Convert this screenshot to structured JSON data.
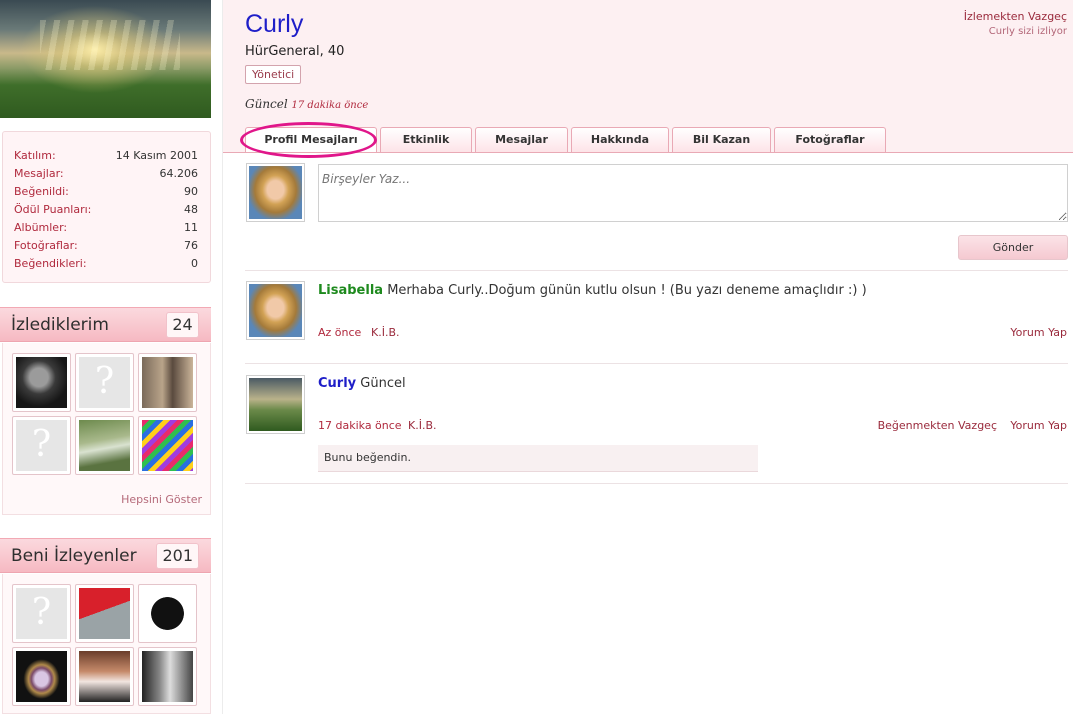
{
  "sidebar": {
    "stats": [
      {
        "label": "Katılım:",
        "value": "14 Kasım 2001"
      },
      {
        "label": "Mesajlar:",
        "value": "64.206"
      },
      {
        "label": "Beğenildi:",
        "value": "90"
      },
      {
        "label": "Ödül Puanları:",
        "value": "48"
      },
      {
        "label": "Albümler:",
        "value": "11"
      },
      {
        "label": "Fotoğraflar:",
        "value": "76"
      },
      {
        "label": "Beğendikleri:",
        "value": "0"
      }
    ],
    "following": {
      "title": "İzlediklerim",
      "count": "24",
      "show_all": "Hepsini Göster"
    },
    "followers": {
      "title": "Beni İzleyenler",
      "count": "201"
    }
  },
  "profile": {
    "username": "Curly",
    "usertitle": "HürGeneral, 40",
    "role": "Yönetici",
    "status_text": "Güncel",
    "status_time": "17 dakika önce",
    "unfollow_label": "İzlemekten Vazgeç",
    "follows_you": "Curly sizi izliyor"
  },
  "tabs": [
    "Profil Mesajları",
    "Etkinlik",
    "Mesajlar",
    "Hakkında",
    "Bil Kazan",
    "Fotoğraflar"
  ],
  "composer": {
    "placeholder": "Birşeyler Yaz...",
    "send_label": "Gönder"
  },
  "posts": [
    {
      "author": "Lisabella",
      "text": "Merhaba Curly..Doğum günün kutlu olsun ! (Bu yazı deneme amaçlıdır :) )",
      "time": "Az önce",
      "kib": "K.İ.B.",
      "reply": "Yorum Yap"
    },
    {
      "author": "Curly",
      "text": "Güncel",
      "time": "17 dakika önce",
      "kib": "K.İ.B.",
      "unlike": "Beğenmekten Vazgeç",
      "reply": "Yorum Yap",
      "liked_note": "Bunu beğendin."
    }
  ]
}
